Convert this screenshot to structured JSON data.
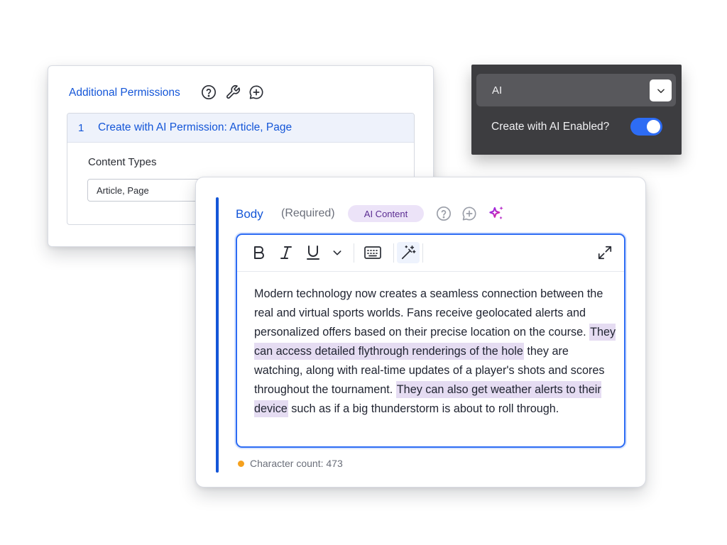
{
  "permissions": {
    "title": "Additional Permissions",
    "item_number": "1",
    "item_label": "Create with AI Permission: Article, Page",
    "content_types_label": "Content Types",
    "content_types_value": "Article, Page"
  },
  "ai_panel": {
    "section_label": "AI",
    "toggle_label": "Create with AI Enabled?",
    "toggle_on": true
  },
  "body_field": {
    "title": "Body",
    "required_label": "(Required)",
    "badge": "AI Content",
    "text_segments": [
      {
        "text": "Modern technology now creates a seamless connection between the real and virtual sports worlds. Fans receive geolocated alerts and personalized offers based on their precise location on the course. ",
        "highlight": false
      },
      {
        "text": "They can access detailed flythrough renderings of the hole",
        "highlight": true
      },
      {
        "text": " they are watching, along with real-time updates of a player's shots and scores throughout the tournament. ",
        "highlight": false
      },
      {
        "text": "They can also get weather alerts to their device",
        "highlight": true
      },
      {
        "text": " such as if a big thunderstorm is about to roll through.",
        "highlight": false
      }
    ],
    "char_count": "Character count: 473"
  },
  "icons": {
    "help": "help-circle-icon",
    "tool": "wrench-icon",
    "comment": "comment-add-icon",
    "sparkle": "ai-sparkle-icon",
    "chevron": "chevron-down-icon",
    "keyboard": "keyboard-icon",
    "magic": "magic-wand-icon",
    "expand": "expand-icon"
  },
  "colors": {
    "accent": "#1456d8",
    "toggle": "#2d6cf4",
    "highlight": "#e5dcf2",
    "badge_bg": "#ece3f8",
    "badge_text": "#5b2d92",
    "sparkle": "#c026d3",
    "status_dot": "#f5a11e",
    "panel_bg": "#3d3d40"
  }
}
